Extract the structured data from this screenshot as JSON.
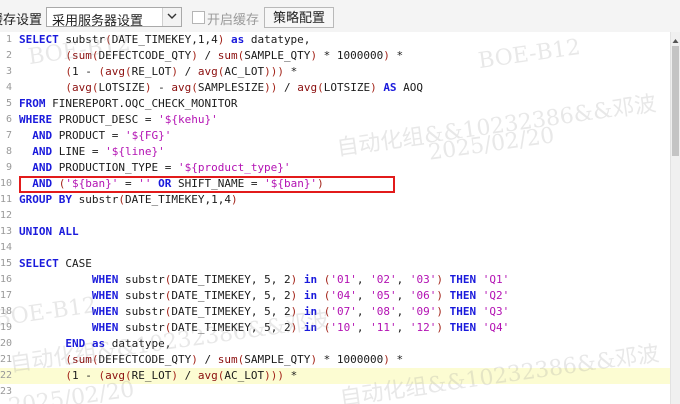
{
  "toolbar": {
    "cache_label": "缓存设置",
    "cache_select_value": "采用服务器设置",
    "enable_cache_label": "开启缓存",
    "strategy_button": "策略配置"
  },
  "editor": {
    "lines": [
      {
        "n": "1",
        "tokens": [
          [
            "kw",
            "SELECT "
          ],
          [
            "ident",
            "substr"
          ],
          [
            "op",
            "("
          ],
          [
            "ident",
            "DATE_TIMEKEY,1,4"
          ],
          [
            "op",
            ")"
          ],
          [
            "ident",
            " "
          ],
          [
            "kw",
            "as"
          ],
          [
            "ident",
            " datatype,"
          ]
        ]
      },
      {
        "n": "2",
        "tokens": [
          [
            "ident",
            "       "
          ],
          [
            "op",
            "("
          ],
          [
            "fn",
            "sum"
          ],
          [
            "op",
            "("
          ],
          [
            "ident",
            "DEFECTCODE_QTY"
          ],
          [
            "op",
            ")"
          ],
          [
            "ident",
            " / "
          ],
          [
            "fn",
            "sum"
          ],
          [
            "op",
            "("
          ],
          [
            "ident",
            "SAMPLE_QTY"
          ],
          [
            "op",
            ")"
          ],
          [
            "ident",
            " * 1000000"
          ],
          [
            "op",
            ")"
          ],
          [
            "ident",
            " *"
          ]
        ]
      },
      {
        "n": "3",
        "tokens": [
          [
            "ident",
            "       "
          ],
          [
            "op",
            "("
          ],
          [
            "ident",
            "1 - "
          ],
          [
            "op",
            "("
          ],
          [
            "fn",
            "avg"
          ],
          [
            "op",
            "("
          ],
          [
            "ident",
            "RE_LOT"
          ],
          [
            "op",
            ")"
          ],
          [
            "ident",
            " / "
          ],
          [
            "fn",
            "avg"
          ],
          [
            "op",
            "("
          ],
          [
            "ident",
            "AC_LOT"
          ],
          [
            "op",
            ")))"
          ],
          [
            "ident",
            " *"
          ]
        ]
      },
      {
        "n": "4",
        "tokens": [
          [
            "ident",
            "       "
          ],
          [
            "op",
            "("
          ],
          [
            "fn",
            "avg"
          ],
          [
            "op",
            "("
          ],
          [
            "ident",
            "LOTSIZE"
          ],
          [
            "op",
            ")"
          ],
          [
            "ident",
            " - "
          ],
          [
            "fn",
            "avg"
          ],
          [
            "op",
            "("
          ],
          [
            "ident",
            "SAMPLESIZE"
          ],
          [
            "op",
            "))"
          ],
          [
            "ident",
            " / "
          ],
          [
            "fn",
            "avg"
          ],
          [
            "op",
            "("
          ],
          [
            "ident",
            "LOTSIZE"
          ],
          [
            "op",
            ")"
          ],
          [
            "ident",
            " "
          ],
          [
            "kw",
            "AS"
          ],
          [
            "ident",
            " AOQ"
          ]
        ]
      },
      {
        "n": "5",
        "tokens": [
          [
            "kw",
            "FROM "
          ],
          [
            "ident",
            "FINEREPORT.OQC_CHECK_MONITOR"
          ]
        ]
      },
      {
        "n": "6",
        "tokens": [
          [
            "kw",
            "WHERE "
          ],
          [
            "ident",
            "PRODUCT_DESC = "
          ],
          [
            "str",
            "'${kehu}'"
          ]
        ]
      },
      {
        "n": "7",
        "tokens": [
          [
            "ident",
            "  "
          ],
          [
            "kw",
            "AND "
          ],
          [
            "ident",
            "PRODUCT = "
          ],
          [
            "str",
            "'${FG}'"
          ]
        ]
      },
      {
        "n": "8",
        "tokens": [
          [
            "ident",
            "  "
          ],
          [
            "kw",
            "AND "
          ],
          [
            "ident",
            "LINE = "
          ],
          [
            "str",
            "'${line}'"
          ]
        ]
      },
      {
        "n": "9",
        "tokens": [
          [
            "ident",
            "  "
          ],
          [
            "kw",
            "AND "
          ],
          [
            "ident",
            "PRODUCTION_TYPE = "
          ],
          [
            "str",
            "'${product_type}'"
          ]
        ]
      },
      {
        "n": "10",
        "tokens": [
          [
            "ident",
            "  "
          ],
          [
            "kw",
            "AND "
          ],
          [
            "op",
            "("
          ],
          [
            "str",
            "'${ban}'"
          ],
          [
            "ident",
            " = "
          ],
          [
            "str",
            "''"
          ],
          [
            "ident",
            " "
          ],
          [
            "kw",
            "OR "
          ],
          [
            "ident",
            "SHIFT_NAME = "
          ],
          [
            "str",
            "'${ban}'"
          ],
          [
            "op",
            ")"
          ]
        ]
      },
      {
        "n": "11",
        "tokens": [
          [
            "kw",
            "GROUP BY "
          ],
          [
            "ident",
            "substr"
          ],
          [
            "op",
            "("
          ],
          [
            "ident",
            "DATE_TIMEKEY,1,4"
          ],
          [
            "op",
            ")"
          ]
        ]
      },
      {
        "n": "12",
        "tokens": []
      },
      {
        "n": "13",
        "tokens": [
          [
            "kw",
            "UNION ALL"
          ]
        ]
      },
      {
        "n": "14",
        "tokens": []
      },
      {
        "n": "15",
        "tokens": [
          [
            "kw",
            "SELECT "
          ],
          [
            "ident",
            "CASE"
          ]
        ]
      },
      {
        "n": "16",
        "tokens": [
          [
            "ident",
            "           "
          ],
          [
            "kw",
            "WHEN "
          ],
          [
            "ident",
            "substr"
          ],
          [
            "op",
            "("
          ],
          [
            "ident",
            "DATE_TIMEKEY, 5, 2"
          ],
          [
            "op",
            ")"
          ],
          [
            "ident",
            " "
          ],
          [
            "kw",
            "in"
          ],
          [
            "ident",
            " "
          ],
          [
            "op",
            "("
          ],
          [
            "str",
            "'01'"
          ],
          [
            "ident",
            ", "
          ],
          [
            "str",
            "'02'"
          ],
          [
            "ident",
            ", "
          ],
          [
            "str",
            "'03'"
          ],
          [
            "op",
            ")"
          ],
          [
            "ident",
            " "
          ],
          [
            "kw",
            "THEN "
          ],
          [
            "str",
            "'Q1'"
          ]
        ]
      },
      {
        "n": "17",
        "tokens": [
          [
            "ident",
            "           "
          ],
          [
            "kw",
            "WHEN "
          ],
          [
            "ident",
            "substr"
          ],
          [
            "op",
            "("
          ],
          [
            "ident",
            "DATE_TIMEKEY, 5, 2"
          ],
          [
            "op",
            ")"
          ],
          [
            "ident",
            " "
          ],
          [
            "kw",
            "in"
          ],
          [
            "ident",
            " "
          ],
          [
            "op",
            "("
          ],
          [
            "str",
            "'04'"
          ],
          [
            "ident",
            ", "
          ],
          [
            "str",
            "'05'"
          ],
          [
            "ident",
            ", "
          ],
          [
            "str",
            "'06'"
          ],
          [
            "op",
            ")"
          ],
          [
            "ident",
            " "
          ],
          [
            "kw",
            "THEN "
          ],
          [
            "str",
            "'Q2'"
          ]
        ]
      },
      {
        "n": "18",
        "tokens": [
          [
            "ident",
            "           "
          ],
          [
            "kw",
            "WHEN "
          ],
          [
            "ident",
            "substr"
          ],
          [
            "op",
            "("
          ],
          [
            "ident",
            "DATE_TIMEKEY, 5, 2"
          ],
          [
            "op",
            ")"
          ],
          [
            "ident",
            " "
          ],
          [
            "kw",
            "in"
          ],
          [
            "ident",
            " "
          ],
          [
            "op",
            "("
          ],
          [
            "str",
            "'07'"
          ],
          [
            "ident",
            ", "
          ],
          [
            "str",
            "'08'"
          ],
          [
            "ident",
            ", "
          ],
          [
            "str",
            "'09'"
          ],
          [
            "op",
            ")"
          ],
          [
            "ident",
            " "
          ],
          [
            "kw",
            "THEN "
          ],
          [
            "str",
            "'Q3'"
          ]
        ]
      },
      {
        "n": "19",
        "tokens": [
          [
            "ident",
            "           "
          ],
          [
            "kw",
            "WHEN "
          ],
          [
            "ident",
            "substr"
          ],
          [
            "op",
            "("
          ],
          [
            "ident",
            "DATE_TIMEKEY, 5, 2"
          ],
          [
            "op",
            ")"
          ],
          [
            "ident",
            " "
          ],
          [
            "kw",
            "in"
          ],
          [
            "ident",
            " "
          ],
          [
            "op",
            "("
          ],
          [
            "str",
            "'10'"
          ],
          [
            "ident",
            ", "
          ],
          [
            "str",
            "'11'"
          ],
          [
            "ident",
            ", "
          ],
          [
            "str",
            "'12'"
          ],
          [
            "op",
            ")"
          ],
          [
            "ident",
            " "
          ],
          [
            "kw",
            "THEN "
          ],
          [
            "str",
            "'Q4'"
          ]
        ]
      },
      {
        "n": "20",
        "tokens": [
          [
            "ident",
            "       "
          ],
          [
            "kw",
            "END as "
          ],
          [
            "ident",
            "datatype,"
          ]
        ]
      },
      {
        "n": "21",
        "tokens": [
          [
            "ident",
            "       "
          ],
          [
            "op",
            "("
          ],
          [
            "fn",
            "sum"
          ],
          [
            "op",
            "("
          ],
          [
            "ident",
            "DEFECTCODE_QTY"
          ],
          [
            "op",
            ")"
          ],
          [
            "ident",
            " / "
          ],
          [
            "fn",
            "sum"
          ],
          [
            "op",
            "("
          ],
          [
            "ident",
            "SAMPLE_QTY"
          ],
          [
            "op",
            ")"
          ],
          [
            "ident",
            " * 1000000"
          ],
          [
            "op",
            ")"
          ],
          [
            "ident",
            " *"
          ]
        ]
      },
      {
        "n": "22",
        "tokens": [
          [
            "ident",
            "       "
          ],
          [
            "op",
            "("
          ],
          [
            "ident",
            "1 - "
          ],
          [
            "op",
            "("
          ],
          [
            "fn",
            "avg"
          ],
          [
            "op",
            "("
          ],
          [
            "ident",
            "RE_LOT"
          ],
          [
            "op",
            ")"
          ],
          [
            "ident",
            " / "
          ],
          [
            "fn",
            "avg"
          ],
          [
            "op",
            "("
          ],
          [
            "ident",
            "AC_LOT"
          ],
          [
            "op",
            ")))"
          ],
          [
            "ident",
            " *"
          ]
        ]
      },
      {
        "n": "23",
        "tokens": []
      }
    ],
    "active_line": 22,
    "highlighted_line": 10
  },
  "watermark": {
    "lines": [
      "BOE-B12",
      "自动化组&&10232386&&邓波",
      "2025/02/20"
    ]
  },
  "colors": {
    "keyword": "#1a1adc",
    "function": "#8a0d0d",
    "string": "#b312b3",
    "highlight_border": "#e21b1b",
    "active_line_bg": "#fcfcd2"
  }
}
